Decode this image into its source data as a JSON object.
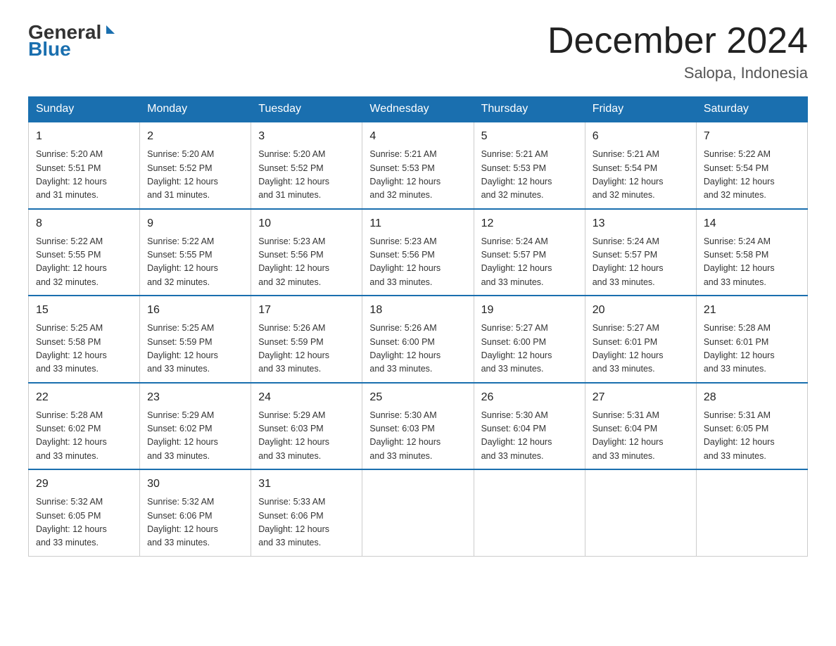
{
  "logo": {
    "general": "General",
    "blue": "Blue"
  },
  "title": "December 2024",
  "location": "Salopa, Indonesia",
  "days_of_week": [
    "Sunday",
    "Monday",
    "Tuesday",
    "Wednesday",
    "Thursday",
    "Friday",
    "Saturday"
  ],
  "weeks": [
    [
      {
        "day": "1",
        "sunrise": "5:20 AM",
        "sunset": "5:51 PM",
        "daylight": "12 hours and 31 minutes."
      },
      {
        "day": "2",
        "sunrise": "5:20 AM",
        "sunset": "5:52 PM",
        "daylight": "12 hours and 31 minutes."
      },
      {
        "day": "3",
        "sunrise": "5:20 AM",
        "sunset": "5:52 PM",
        "daylight": "12 hours and 31 minutes."
      },
      {
        "day": "4",
        "sunrise": "5:21 AM",
        "sunset": "5:53 PM",
        "daylight": "12 hours and 32 minutes."
      },
      {
        "day": "5",
        "sunrise": "5:21 AM",
        "sunset": "5:53 PM",
        "daylight": "12 hours and 32 minutes."
      },
      {
        "day": "6",
        "sunrise": "5:21 AM",
        "sunset": "5:54 PM",
        "daylight": "12 hours and 32 minutes."
      },
      {
        "day": "7",
        "sunrise": "5:22 AM",
        "sunset": "5:54 PM",
        "daylight": "12 hours and 32 minutes."
      }
    ],
    [
      {
        "day": "8",
        "sunrise": "5:22 AM",
        "sunset": "5:55 PM",
        "daylight": "12 hours and 32 minutes."
      },
      {
        "day": "9",
        "sunrise": "5:22 AM",
        "sunset": "5:55 PM",
        "daylight": "12 hours and 32 minutes."
      },
      {
        "day": "10",
        "sunrise": "5:23 AM",
        "sunset": "5:56 PM",
        "daylight": "12 hours and 32 minutes."
      },
      {
        "day": "11",
        "sunrise": "5:23 AM",
        "sunset": "5:56 PM",
        "daylight": "12 hours and 33 minutes."
      },
      {
        "day": "12",
        "sunrise": "5:24 AM",
        "sunset": "5:57 PM",
        "daylight": "12 hours and 33 minutes."
      },
      {
        "day": "13",
        "sunrise": "5:24 AM",
        "sunset": "5:57 PM",
        "daylight": "12 hours and 33 minutes."
      },
      {
        "day": "14",
        "sunrise": "5:24 AM",
        "sunset": "5:58 PM",
        "daylight": "12 hours and 33 minutes."
      }
    ],
    [
      {
        "day": "15",
        "sunrise": "5:25 AM",
        "sunset": "5:58 PM",
        "daylight": "12 hours and 33 minutes."
      },
      {
        "day": "16",
        "sunrise": "5:25 AM",
        "sunset": "5:59 PM",
        "daylight": "12 hours and 33 minutes."
      },
      {
        "day": "17",
        "sunrise": "5:26 AM",
        "sunset": "5:59 PM",
        "daylight": "12 hours and 33 minutes."
      },
      {
        "day": "18",
        "sunrise": "5:26 AM",
        "sunset": "6:00 PM",
        "daylight": "12 hours and 33 minutes."
      },
      {
        "day": "19",
        "sunrise": "5:27 AM",
        "sunset": "6:00 PM",
        "daylight": "12 hours and 33 minutes."
      },
      {
        "day": "20",
        "sunrise": "5:27 AM",
        "sunset": "6:01 PM",
        "daylight": "12 hours and 33 minutes."
      },
      {
        "day": "21",
        "sunrise": "5:28 AM",
        "sunset": "6:01 PM",
        "daylight": "12 hours and 33 minutes."
      }
    ],
    [
      {
        "day": "22",
        "sunrise": "5:28 AM",
        "sunset": "6:02 PM",
        "daylight": "12 hours and 33 minutes."
      },
      {
        "day": "23",
        "sunrise": "5:29 AM",
        "sunset": "6:02 PM",
        "daylight": "12 hours and 33 minutes."
      },
      {
        "day": "24",
        "sunrise": "5:29 AM",
        "sunset": "6:03 PM",
        "daylight": "12 hours and 33 minutes."
      },
      {
        "day": "25",
        "sunrise": "5:30 AM",
        "sunset": "6:03 PM",
        "daylight": "12 hours and 33 minutes."
      },
      {
        "day": "26",
        "sunrise": "5:30 AM",
        "sunset": "6:04 PM",
        "daylight": "12 hours and 33 minutes."
      },
      {
        "day": "27",
        "sunrise": "5:31 AM",
        "sunset": "6:04 PM",
        "daylight": "12 hours and 33 minutes."
      },
      {
        "day": "28",
        "sunrise": "5:31 AM",
        "sunset": "6:05 PM",
        "daylight": "12 hours and 33 minutes."
      }
    ],
    [
      {
        "day": "29",
        "sunrise": "5:32 AM",
        "sunset": "6:05 PM",
        "daylight": "12 hours and 33 minutes."
      },
      {
        "day": "30",
        "sunrise": "5:32 AM",
        "sunset": "6:06 PM",
        "daylight": "12 hours and 33 minutes."
      },
      {
        "day": "31",
        "sunrise": "5:33 AM",
        "sunset": "6:06 PM",
        "daylight": "12 hours and 33 minutes."
      },
      null,
      null,
      null,
      null
    ]
  ],
  "labels": {
    "sunrise": "Sunrise:",
    "sunset": "Sunset:",
    "daylight": "Daylight:"
  }
}
